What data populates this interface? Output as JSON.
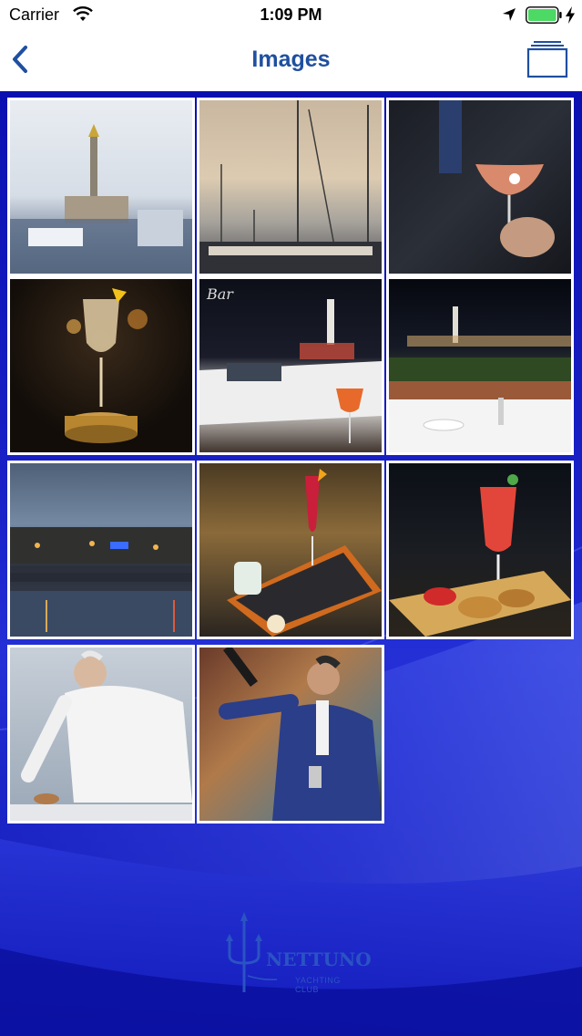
{
  "status_bar": {
    "carrier": "Carrier",
    "time": "1:09 PM"
  },
  "nav": {
    "title": "Images",
    "back_icon": "chevron-left-icon",
    "right_icon": "albums-stack-icon"
  },
  "colors": {
    "accent": "#1f4fa0",
    "background_blue": "#1a22c8",
    "battery_green": "#4cd964"
  },
  "gallery": {
    "images": [
      {
        "subject": "harbor-lighthouse"
      },
      {
        "subject": "sailboat-masts"
      },
      {
        "subject": "cocktail-in-hand"
      },
      {
        "subject": "cocktail-on-wood-base"
      },
      {
        "subject": "yacht-at-night"
      },
      {
        "subject": "terrace-restaurant-night"
      },
      {
        "subject": "marina-at-dusk"
      },
      {
        "subject": "red-cocktail-mirror-tray"
      },
      {
        "subject": "cocktail-with-bruschetta"
      },
      {
        "subject": "chef-plating"
      },
      {
        "subject": "bartender-mixing"
      }
    ]
  },
  "logo": {
    "name": "NETTUNO",
    "subtitle": "YACHTING CLUB",
    "icon": "trident-icon"
  }
}
